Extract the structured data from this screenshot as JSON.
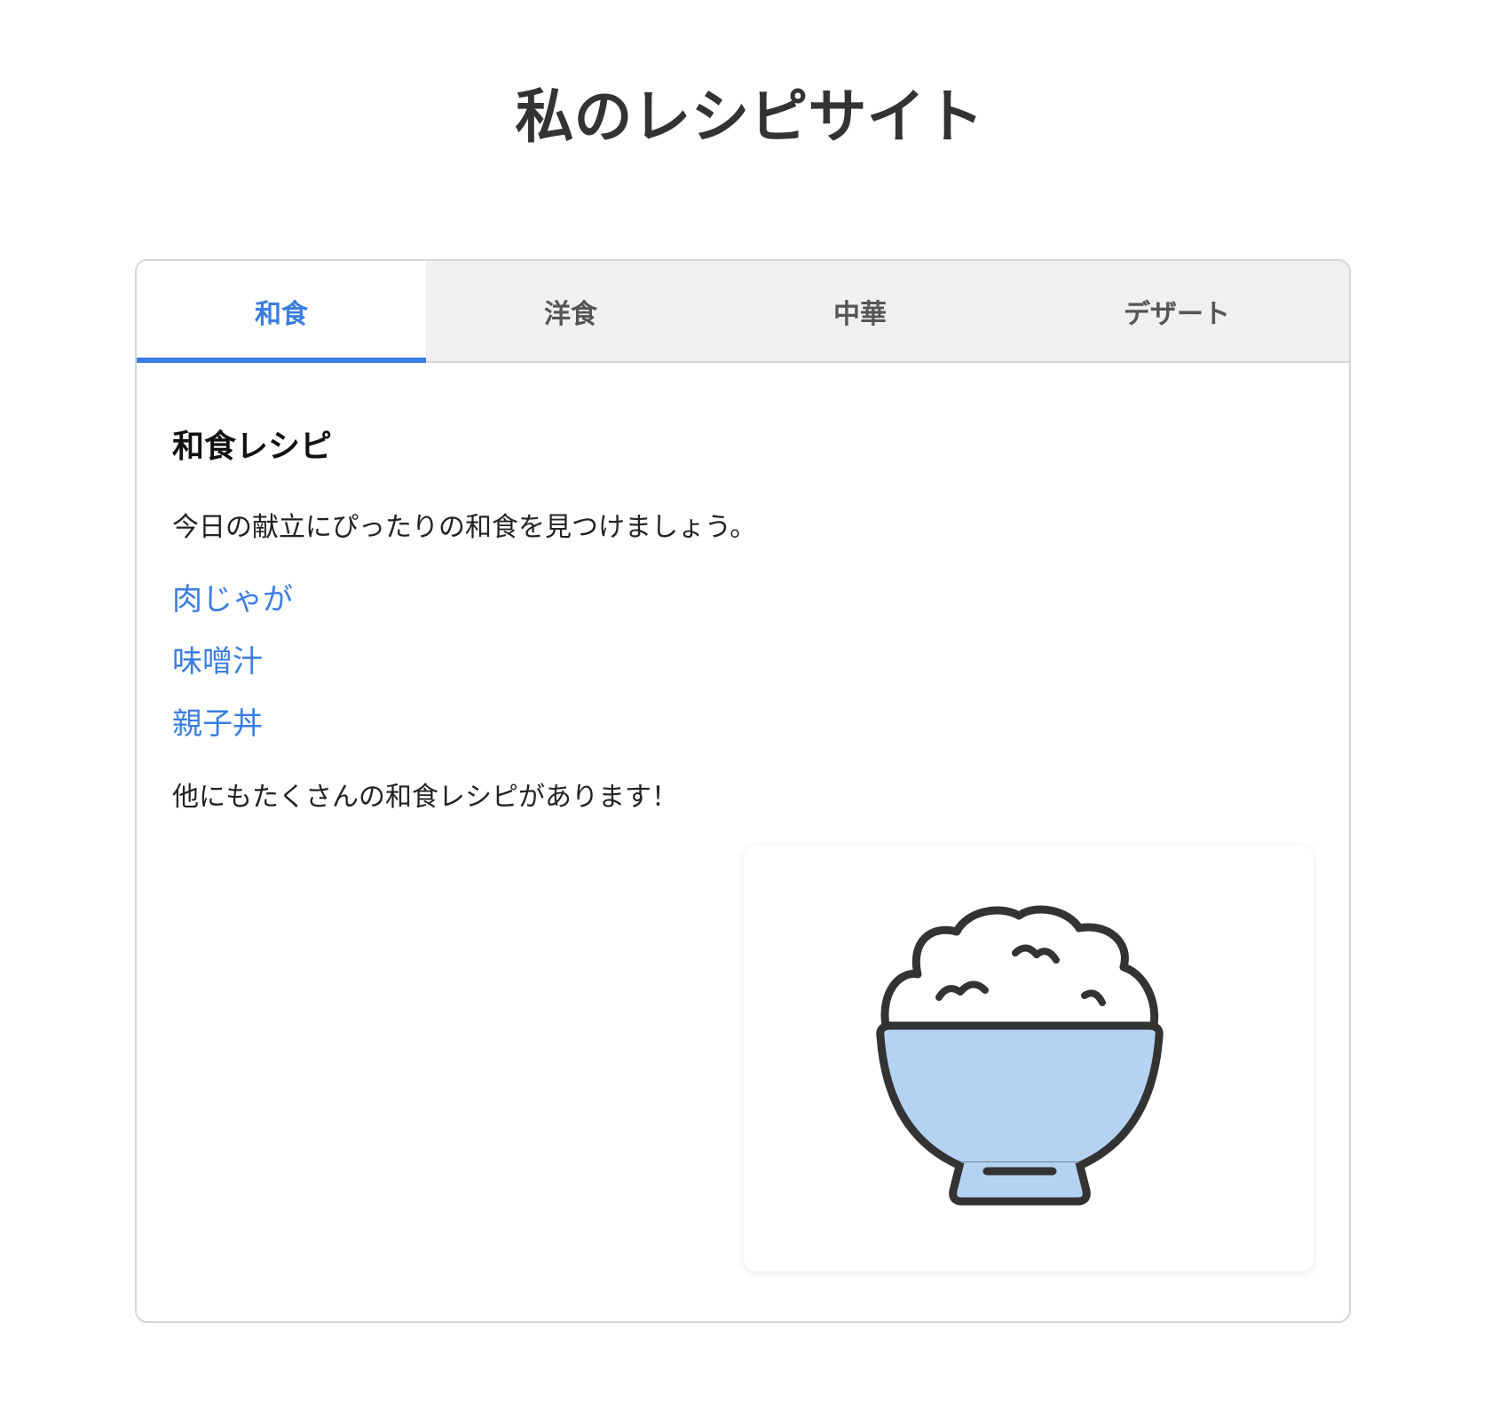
{
  "site": {
    "title": "私のレシピサイト"
  },
  "tabs": [
    {
      "label": "和食",
      "active": true
    },
    {
      "label": "洋食",
      "active": false
    },
    {
      "label": "中華",
      "active": false
    },
    {
      "label": "デザート",
      "active": false
    }
  ],
  "content": {
    "heading": "和食レシピ",
    "intro": "今日の献立にぴったりの和食を見つけましょう。",
    "recipes": [
      {
        "label": "肉じゃが"
      },
      {
        "label": "味噌汁"
      },
      {
        "label": "親子丼"
      }
    ],
    "outro": "他にもたくさんの和食レシピがあります！",
    "image": {
      "icon": "rice-bowl-icon"
    }
  },
  "colors": {
    "accent": "#3a7de0",
    "bowl_fill": "#b4d2f2",
    "outline": "#333333",
    "tab_bar_bg": "#f0f0f0"
  }
}
